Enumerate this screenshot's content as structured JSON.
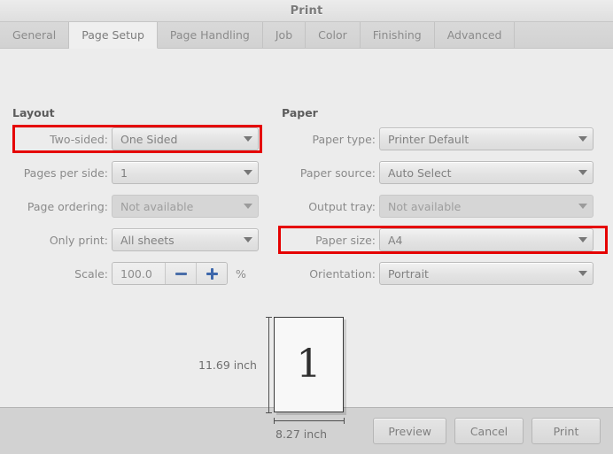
{
  "window": {
    "title": "Print"
  },
  "tabs": [
    {
      "label": "General",
      "active": false
    },
    {
      "label": "Page Setup",
      "active": true
    },
    {
      "label": "Page Handling",
      "active": false
    },
    {
      "label": "Job",
      "active": false
    },
    {
      "label": "Color",
      "active": false
    },
    {
      "label": "Finishing",
      "active": false
    },
    {
      "label": "Advanced",
      "active": false
    }
  ],
  "layout": {
    "title": "Layout",
    "two_sided": {
      "label": "Two-sided:",
      "value": "One Sided",
      "highlighted": true
    },
    "pages_per_side": {
      "label": "Pages per side:",
      "value": "1"
    },
    "page_ordering": {
      "label": "Page ordering:",
      "value": "Not available",
      "disabled": true
    },
    "only_print": {
      "label": "Only print:",
      "value": "All sheets"
    },
    "scale": {
      "label": "Scale:",
      "value": "100.0",
      "unit": "%",
      "minus_icon": "minus-icon",
      "plus_icon": "plus-icon"
    }
  },
  "paper": {
    "title": "Paper",
    "paper_type": {
      "label": "Paper type:",
      "value": "Printer Default"
    },
    "paper_source": {
      "label": "Paper source:",
      "value": "Auto Select"
    },
    "output_tray": {
      "label": "Output tray:",
      "value": "Not available",
      "disabled": true
    },
    "paper_size": {
      "label": "Paper size:",
      "value": "A4",
      "highlighted": true
    },
    "orientation": {
      "label": "Orientation:",
      "value": "Portrait"
    }
  },
  "preview": {
    "page_number": "1",
    "height_label": "11.69 inch",
    "width_label": "8.27 inch"
  },
  "footer": {
    "preview_label": "Preview",
    "cancel_label": "Cancel",
    "print_label": "Print"
  },
  "colors": {
    "highlight": "#e50000",
    "accent_blue": "#3d67ab",
    "window_bg": "#ececec",
    "footer_bg": "#d2d2d2"
  }
}
